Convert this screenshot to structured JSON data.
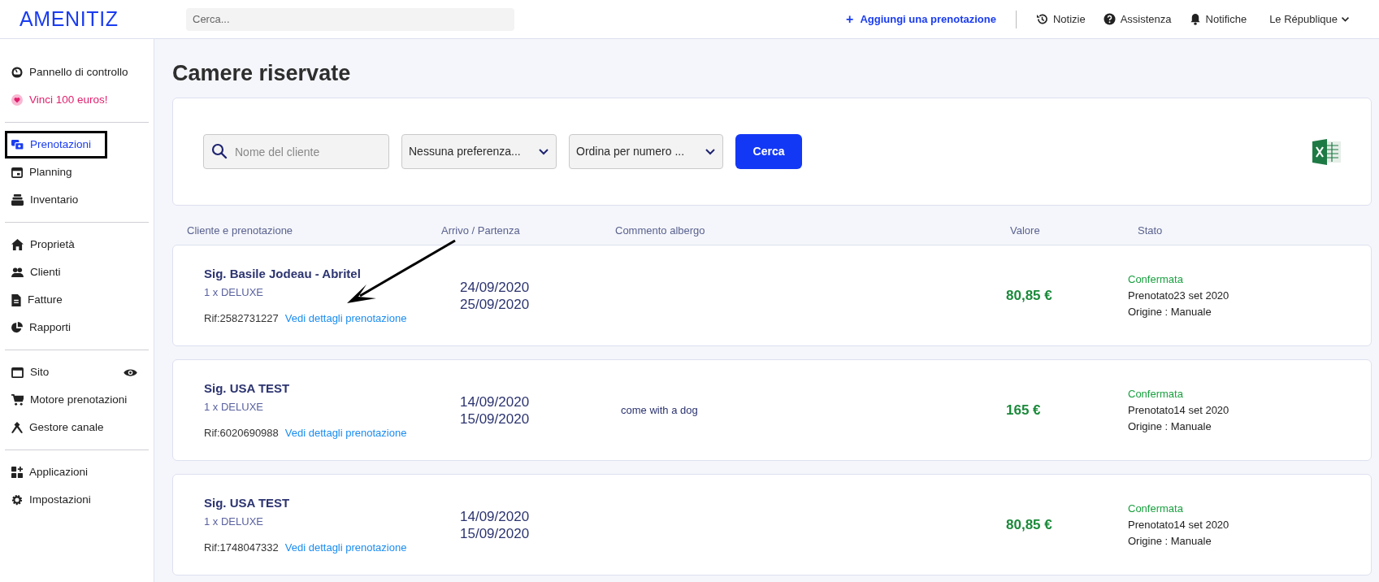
{
  "header": {
    "logo": "AMENITIZ",
    "search": {
      "placeholder": "Cerca..."
    },
    "add_booking": {
      "icon": "+",
      "label": "Aggiungi una prenotazione"
    },
    "links": [
      {
        "label": "Notizie"
      },
      {
        "label": "Assistenza"
      },
      {
        "label": "Notifiche"
      }
    ],
    "property": "Le République"
  },
  "sidebar": {
    "groups": [
      {
        "items": [
          {
            "label": "Pannello di controllo",
            "kind": "link",
            "selected": false
          },
          {
            "label": "Vinci 100 euros!",
            "kind": "promo",
            "selected": false
          }
        ]
      },
      {
        "items": [
          {
            "label": "Prenotazioni",
            "kind": "link",
            "selected": true
          },
          {
            "label": "Planning",
            "kind": "link",
            "selected": false
          },
          {
            "label": "Inventario",
            "kind": "link",
            "selected": false
          }
        ]
      },
      {
        "items": [
          {
            "label": "Proprietà",
            "kind": "link",
            "selected": false
          },
          {
            "label": "Clienti",
            "kind": "link",
            "selected": false
          },
          {
            "label": "Fatture",
            "kind": "link",
            "selected": false
          },
          {
            "label": "Rapporti",
            "kind": "link",
            "selected": false
          }
        ]
      },
      {
        "items": [
          {
            "label": "Sito",
            "kind": "preview",
            "selected": false
          },
          {
            "label": "Motore prenotazioni",
            "kind": "link",
            "selected": false
          },
          {
            "label": "Gestore canale",
            "kind": "link",
            "selected": false
          }
        ]
      },
      {
        "items": [
          {
            "label": "Applicazioni",
            "kind": "link",
            "selected": false
          },
          {
            "label": "Impostazioni",
            "kind": "link",
            "selected": false
          }
        ]
      }
    ]
  },
  "page_title": "Camere riservate",
  "filters": {
    "client_search": {
      "placeholder": "Nome del cliente"
    },
    "preference": "Nessuna preferenza...",
    "sort": "Ordina per numero ...",
    "search_button": "Cerca"
  },
  "table": {
    "columns": [
      "Cliente e prenotazione",
      "Arrivo / Partenza",
      "Commento albergo",
      "Valore",
      "Stato"
    ],
    "rows": [
      {
        "guest": "Sig. Basile Jodeau - Abritel",
        "room": "1 x DELUXE",
        "ref": "Rif:2582731227",
        "details_link": "Vedi dettagli prenotazione",
        "arrival": "24/09/2020",
        "departure": "25/09/2020",
        "comment": "",
        "value": "80,85 €",
        "status": "Confermata",
        "booked": "Prenotato23 set 2020",
        "origin": "Origine : Manuale"
      },
      {
        "guest": "Sig. USA TEST",
        "room": "1 x DELUXE",
        "ref": "Rif:6020690988",
        "details_link": "Vedi dettagli prenotazione",
        "arrival": "14/09/2020",
        "departure": "15/09/2020",
        "comment": "come with a dog",
        "value": "165 €",
        "status": "Confermata",
        "booked": "Prenotato14 set 2020",
        "origin": "Origine : Manuale"
      },
      {
        "guest": "Sig. USA TEST",
        "room": "1 x DELUXE",
        "ref": "Rif:1748047332",
        "details_link": "Vedi dettagli prenotazione",
        "arrival": "14/09/2020",
        "departure": "15/09/2020",
        "comment": "",
        "value": "80,85 €",
        "status": "Confermata",
        "booked": "Prenotato14 set 2020",
        "origin": "Origine : Manuale"
      }
    ]
  }
}
